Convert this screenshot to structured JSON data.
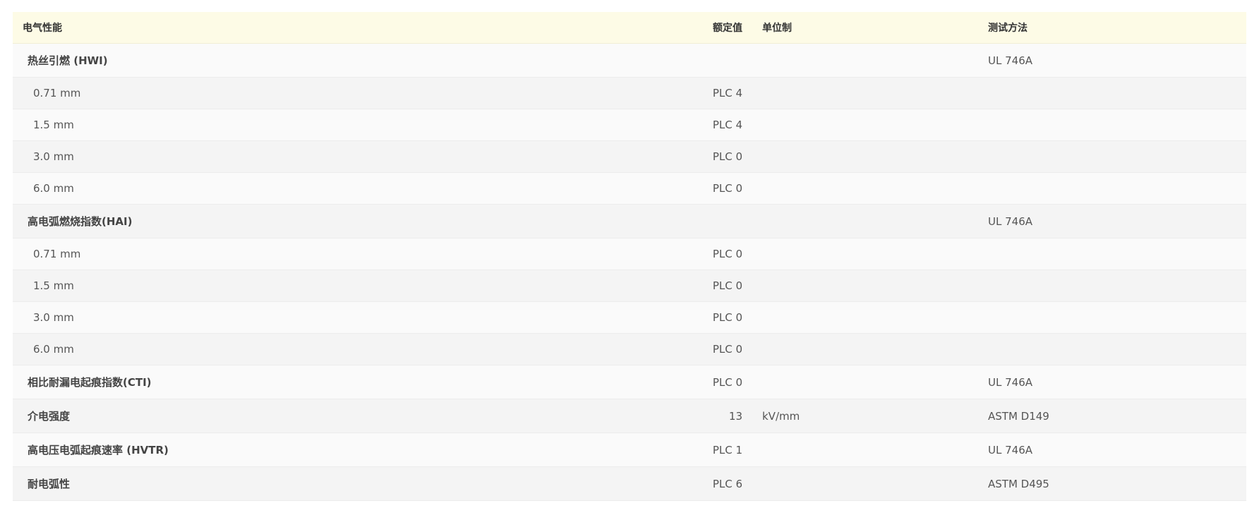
{
  "table": {
    "headers": {
      "property": "电气性能",
      "rated": "额定值",
      "unit": "单位制",
      "method": "测试方法"
    },
    "rows": [
      {
        "name": "热丝引燃 (HWI)",
        "rated": "",
        "unit": "",
        "method": "UL 746A",
        "kind": "group"
      },
      {
        "name": "0.71 mm",
        "rated": "PLC 4",
        "unit": "",
        "method": "",
        "kind": "sub"
      },
      {
        "name": "1.5 mm",
        "rated": "PLC 4",
        "unit": "",
        "method": "",
        "kind": "sub"
      },
      {
        "name": "3.0 mm",
        "rated": "PLC 0",
        "unit": "",
        "method": "",
        "kind": "sub"
      },
      {
        "name": "6.0 mm",
        "rated": "PLC 0",
        "unit": "",
        "method": "",
        "kind": "sub"
      },
      {
        "name": "高电弧燃烧指数(HAI)",
        "rated": "",
        "unit": "",
        "method": "UL 746A",
        "kind": "group"
      },
      {
        "name": "0.71 mm",
        "rated": "PLC 0",
        "unit": "",
        "method": "",
        "kind": "sub"
      },
      {
        "name": "1.5 mm",
        "rated": "PLC 0",
        "unit": "",
        "method": "",
        "kind": "sub"
      },
      {
        "name": "3.0 mm",
        "rated": "PLC 0",
        "unit": "",
        "method": "",
        "kind": "sub"
      },
      {
        "name": "6.0 mm",
        "rated": "PLC 0",
        "unit": "",
        "method": "",
        "kind": "sub"
      },
      {
        "name": "相比耐漏电起痕指数(CTI)",
        "rated": "PLC 0",
        "unit": "",
        "method": "UL 746A",
        "kind": "group"
      },
      {
        "name": "介电强度",
        "rated": "13",
        "unit": "kV/mm",
        "method": "ASTM D149",
        "kind": "group"
      },
      {
        "name": "高电压电弧起痕速率 (HVTR)",
        "rated": "PLC 1",
        "unit": "",
        "method": "UL 746A",
        "kind": "group"
      },
      {
        "name": "耐电弧性",
        "rated": "PLC 6",
        "unit": "",
        "method": "ASTM D495",
        "kind": "group"
      }
    ]
  }
}
